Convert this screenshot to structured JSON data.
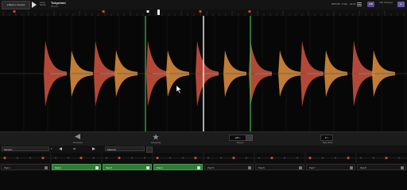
{
  "header": {
    "back_label": "◂ Back to browse",
    "mode_label": "Loop Mode",
    "title": "Tokyohmi",
    "subtitle": "Drums",
    "bpm_readout": "BPM 85 · 8 bar · 04:01",
    "badge_mid": "A/B",
    "small_label": "Clip Settings",
    "badge_right": "▸"
  },
  "controls": {
    "left_caption": "Previous",
    "mid_caption": "Favourite",
    "tempo_value": "125 ↕",
    "tempo_caption": "Tempo",
    "step_value": "8 ↕",
    "step_caption": "Step Size"
  },
  "selectors": {
    "left_label": "Melodic",
    "mid_value": "01",
    "right_label": "Material"
  },
  "pads": [
    {
      "label": "Pad 1",
      "active": false
    },
    {
      "label": "Pad 2",
      "active": true
    },
    {
      "label": "Pad 3",
      "active": true
    },
    {
      "label": "Pad 4",
      "active": true
    },
    {
      "label": "Pad 5",
      "active": false
    },
    {
      "label": "Pad 6",
      "active": false
    },
    {
      "label": "Pad 7",
      "active": false
    },
    {
      "label": "Pad 8",
      "active": false
    }
  ],
  "colors": {
    "accent_green": "#3fb950",
    "playhead": "#f2f2f2",
    "wave_red": "#c8503c",
    "wave_orange": "#d88a3a",
    "wave_gray": "#8a8a82",
    "button_purple": "#6a5aa8"
  },
  "transients_count": 16
}
